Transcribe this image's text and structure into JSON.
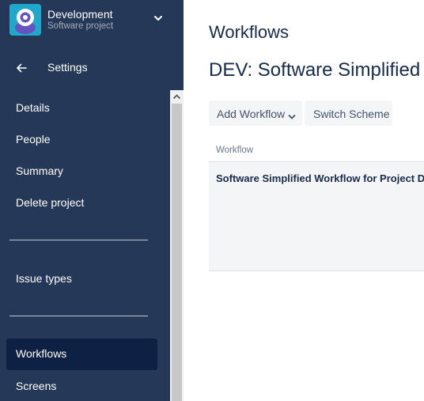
{
  "project": {
    "name": "Development",
    "type": "Software project"
  },
  "nav": {
    "back_label": "Settings",
    "items": [
      {
        "label": "Details"
      },
      {
        "label": "People"
      },
      {
        "label": "Summary"
      },
      {
        "label": "Delete project"
      },
      {
        "label": "Issue types"
      },
      {
        "label": "Workflows",
        "active": true
      },
      {
        "label": "Screens"
      }
    ]
  },
  "main": {
    "page_title": "Workflows",
    "scheme_title": "DEV: Software Simplified Workflow Scheme",
    "buttons": {
      "add_workflow": "Add Workflow",
      "switch_scheme": "Switch Scheme"
    },
    "table": {
      "column_header": "Workflow",
      "rows": [
        {
          "workflow": "Software Simplified Workflow for Project DEV"
        }
      ]
    }
  },
  "colors": {
    "sidebar_bg": "#253858",
    "sidebar_active": "#0e2044",
    "avatar_bg": "#1fa8c9",
    "text_dark": "#172b4d"
  }
}
